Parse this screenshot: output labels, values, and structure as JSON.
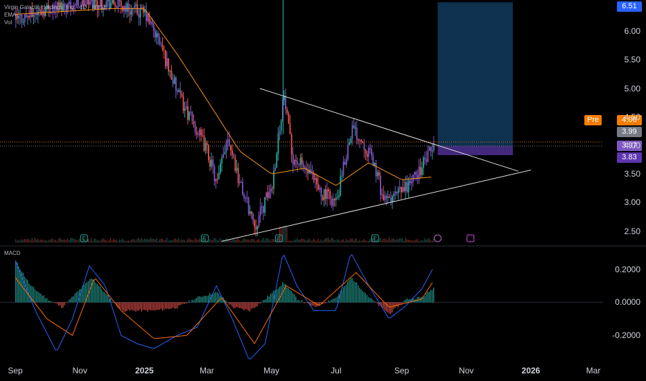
{
  "header": {
    "title": "Virgin Galactic Holdings, Inc. · 1D · NYSE",
    "ema_label": "EMA",
    "vol_label": "Vol",
    "macd_label": "MACD"
  },
  "colors": {
    "up": "#26a69a",
    "down": "#ef5350",
    "candle_highlight": "#7e57c2",
    "ema": "#f7931a",
    "macd_line": "#2962ff",
    "signal_line": "#ff6d00",
    "hist_pos": "#26a69a",
    "hist_neg": "#ef5350",
    "target_box": "#0f3a5c",
    "stop_box": "#4a2d8a"
  },
  "price_tags": {
    "top": "6.51",
    "pre_label": "Pre",
    "pre_value": "4.06",
    "current": "3.99",
    "tag2": "3.97",
    "tag3": "3.83"
  },
  "chart_data": [
    {
      "type": "candlestick",
      "title": "Virgin Galactic Holdings, Inc. · 1D · NYSE",
      "x_ticks": [
        "Sep",
        "Nov",
        "2025",
        "Mar",
        "May",
        "Jul",
        "Sep",
        "Nov",
        "2026",
        "Mar"
      ],
      "y_ticks": [
        "2.50",
        "3.00",
        "3.50",
        "4.00",
        "4.50",
        "5.00",
        "5.50",
        "6.00"
      ],
      "ylim": [
        2.3,
        6.55
      ],
      "price_path": [
        [
          "2024-09-01",
          6.2
        ],
        [
          "2024-10-01",
          6.4
        ],
        [
          "2024-11-01",
          6.5
        ],
        [
          "2024-12-01",
          6.5
        ],
        [
          "2025-01-01",
          6.3
        ],
        [
          "2025-01-15",
          5.8
        ],
        [
          "2025-02-01",
          4.9
        ],
        [
          "2025-02-15",
          4.4
        ],
        [
          "2025-03-01",
          3.9
        ],
        [
          "2025-03-10",
          3.3
        ],
        [
          "2025-03-20",
          4.2
        ],
        [
          "2025-04-01",
          3.3
        ],
        [
          "2025-04-15",
          2.6
        ],
        [
          "2025-05-01",
          3.3
        ],
        [
          "2025-05-12",
          4.9
        ],
        [
          "2025-05-20",
          3.8
        ],
        [
          "2025-06-01",
          3.6
        ],
        [
          "2025-06-15",
          3.2
        ],
        [
          "2025-07-01",
          3.0
        ],
        [
          "2025-07-15",
          4.3
        ],
        [
          "2025-07-25",
          4.1
        ],
        [
          "2025-08-05",
          3.7
        ],
        [
          "2025-08-15",
          3.0
        ],
        [
          "2025-09-01",
          3.2
        ],
        [
          "2025-09-15",
          3.5
        ],
        [
          "2025-09-25",
          3.8
        ],
        [
          "2025-10-01",
          3.99
        ]
      ],
      "ema": [
        [
          "2024-09-01",
          6.3
        ],
        [
          "2024-12-01",
          6.4
        ],
        [
          "2025-01-01",
          6.4
        ],
        [
          "2025-02-01",
          5.6
        ],
        [
          "2025-03-01",
          4.8
        ],
        [
          "2025-04-01",
          3.9
        ],
        [
          "2025-05-01",
          3.5
        ],
        [
          "2025-06-01",
          3.6
        ],
        [
          "2025-07-01",
          3.3
        ],
        [
          "2025-08-01",
          3.7
        ],
        [
          "2025-09-01",
          3.4
        ],
        [
          "2025-10-01",
          3.45
        ]
      ],
      "trendlines": {
        "upper": [
          [
            "2025-04-20",
            5.0
          ],
          [
            "2025-12-20",
            3.55
          ]
        ],
        "lower": [
          [
            "2025-03-15",
            2.32
          ],
          [
            "2026-01-01",
            3.57
          ]
        ]
      },
      "position": {
        "entry": 3.99,
        "target": 6.51,
        "stop": 3.83
      }
    },
    {
      "type": "macd",
      "title": "MACD",
      "y_ticks": [
        "0.2000",
        "0.0000",
        "-0.2000"
      ],
      "ylim": [
        -0.35,
        0.32
      ],
      "macd": [
        [
          "2024-09-01",
          0.25
        ],
        [
          "2024-09-20",
          -0.05
        ],
        [
          "2024-10-10",
          -0.3
        ],
        [
          "2024-10-25",
          -0.1
        ],
        [
          "2024-11-10",
          0.22
        ],
        [
          "2024-11-25",
          0.1
        ],
        [
          "2024-12-10",
          -0.2
        ],
        [
          "2024-12-25",
          -0.25
        ],
        [
          "2025-01-10",
          -0.28
        ],
        [
          "2025-02-01",
          -0.2
        ],
        [
          "2025-02-20",
          -0.15
        ],
        [
          "2025-03-10",
          0.1
        ],
        [
          "2025-03-25",
          -0.1
        ],
        [
          "2025-04-10",
          -0.35
        ],
        [
          "2025-04-25",
          -0.25
        ],
        [
          "2025-05-12",
          0.3
        ],
        [
          "2025-05-25",
          0.1
        ],
        [
          "2025-06-10",
          -0.05
        ],
        [
          "2025-07-01",
          -0.05
        ],
        [
          "2025-07-15",
          0.3
        ],
        [
          "2025-08-01",
          0.1
        ],
        [
          "2025-08-20",
          -0.1
        ],
        [
          "2025-09-05",
          -0.02
        ],
        [
          "2025-09-20",
          0.08
        ],
        [
          "2025-10-01",
          0.21
        ]
      ],
      "signal": [
        [
          "2024-09-01",
          0.15
        ],
        [
          "2024-10-01",
          -0.1
        ],
        [
          "2024-10-25",
          -0.2
        ],
        [
          "2024-11-15",
          0.15
        ],
        [
          "2024-12-10",
          -0.05
        ],
        [
          "2025-01-10",
          -0.22
        ],
        [
          "2025-02-10",
          -0.2
        ],
        [
          "2025-03-15",
          0.03
        ],
        [
          "2025-04-15",
          -0.25
        ],
        [
          "2025-05-15",
          0.1
        ],
        [
          "2025-06-15",
          -0.02
        ],
        [
          "2025-07-20",
          0.18
        ],
        [
          "2025-08-20",
          -0.03
        ],
        [
          "2025-09-20",
          0.02
        ],
        [
          "2025-10-01",
          0.13
        ]
      ],
      "histogram": [
        [
          "2024-09-01",
          0.25
        ],
        [
          "2024-09-15",
          0.1
        ],
        [
          "2024-10-01",
          0.02
        ],
        [
          "2024-10-15",
          -0.03
        ],
        [
          "2024-11-01",
          0.08
        ],
        [
          "2024-11-12",
          0.15
        ],
        [
          "2024-11-25",
          0.05
        ],
        [
          "2024-12-10",
          -0.05
        ],
        [
          "2024-12-25",
          -0.05
        ],
        [
          "2025-01-10",
          -0.05
        ],
        [
          "2025-02-01",
          -0.03
        ],
        [
          "2025-02-20",
          0.03
        ],
        [
          "2025-03-10",
          0.06
        ],
        [
          "2025-03-25",
          -0.03
        ],
        [
          "2025-04-10",
          -0.05
        ],
        [
          "2025-04-25",
          0.02
        ],
        [
          "2025-05-12",
          0.12
        ],
        [
          "2025-05-25",
          0.02
        ],
        [
          "2025-06-10",
          -0.03
        ],
        [
          "2025-07-01",
          0.03
        ],
        [
          "2025-07-15",
          0.15
        ],
        [
          "2025-08-01",
          0.03
        ],
        [
          "2025-08-20",
          -0.07
        ],
        [
          "2025-09-05",
          0.02
        ],
        [
          "2025-09-20",
          0.03
        ],
        [
          "2025-10-01",
          0.09
        ]
      ]
    }
  ]
}
